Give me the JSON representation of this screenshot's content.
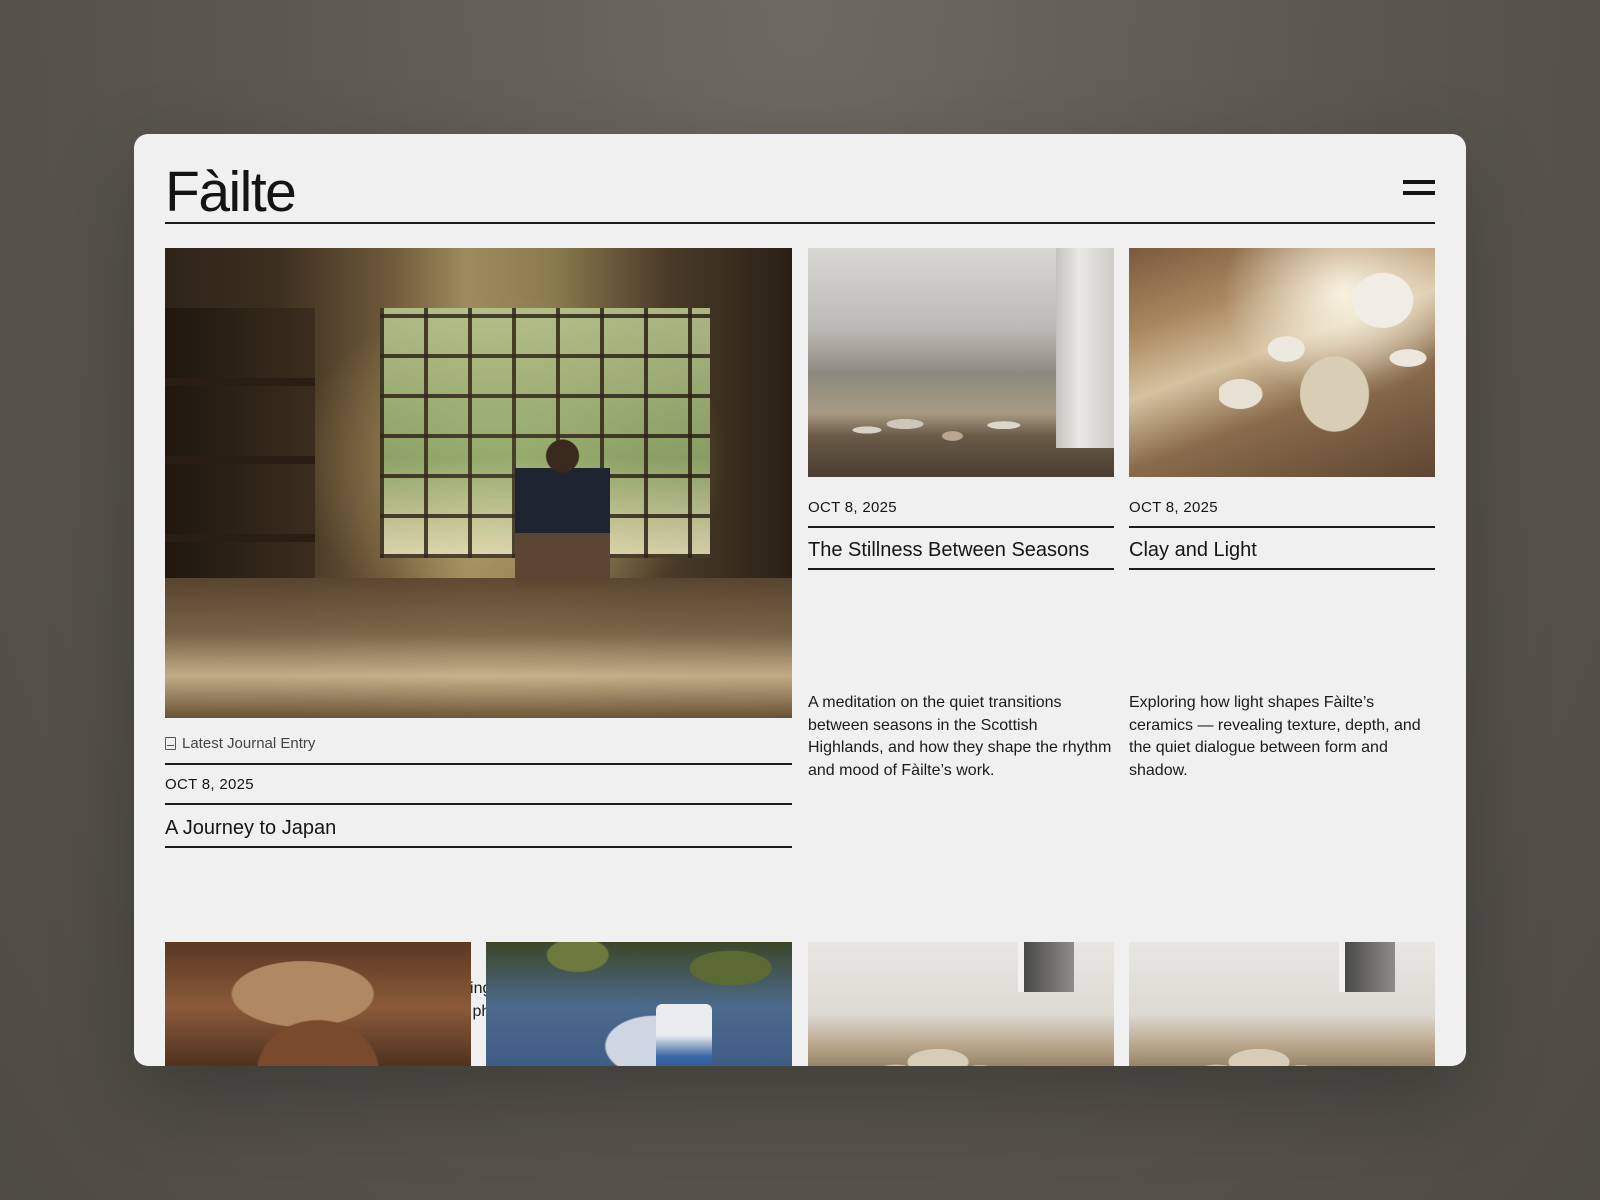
{
  "brand": {
    "logo_text": "Fàilte"
  },
  "header": {
    "menu_icon": "hamburger-menu-icon"
  },
  "feature": {
    "tag_icon": "book-icon",
    "tag_label": "Latest Journal Entry",
    "date": "OCT 8, 2025",
    "title": "A Journey to Japan",
    "description": "Fàilte reflects on a journey to Japan — tracing the roots of wabi-sabi and the quiet beauty that continues to shape the studio’s philosophy."
  },
  "cards": [
    {
      "date": "OCT 8, 2025",
      "title": "The Stillness Between Seasons",
      "description": "A meditation on the quiet transitions between seasons in the Scottish Highlands, and how they shape the rhythm and mood of Fàilte’s work."
    },
    {
      "date": "OCT 8, 2025",
      "title": "Clay and Light",
      "description": "Exploring how light shapes Fàilte’s ceramics — revealing texture, depth, and the quiet dialogue between form and shadow."
    }
  ],
  "colors": {
    "backdrop": "#5a5750",
    "panel": "#f0f0f0",
    "text": "#151515",
    "rule": "#1c1c1c"
  }
}
